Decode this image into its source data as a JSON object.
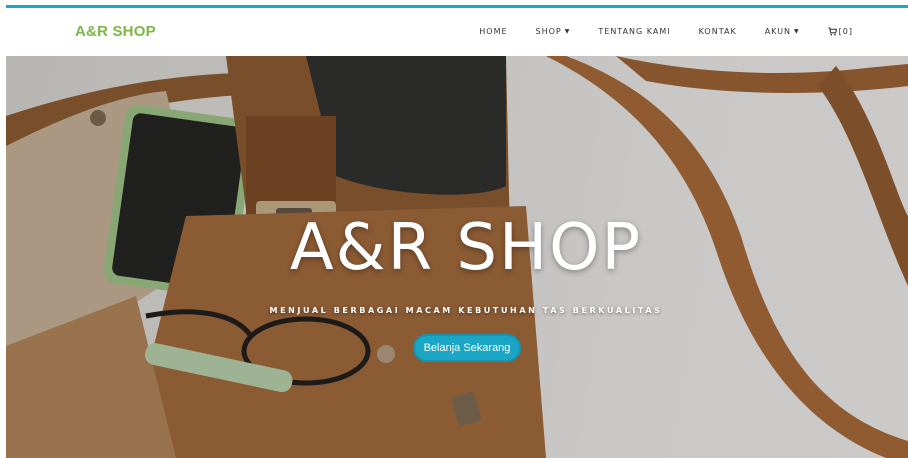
{
  "brand": {
    "name": "A&R SHOP"
  },
  "nav": {
    "home": "HOME",
    "shop": "SHOP",
    "about": "TENTANG KAMI",
    "contact": "KONTAK",
    "account": "AKUN",
    "cart_count": "[0]"
  },
  "hero": {
    "title": "A&R SHOP",
    "subtitle": "MENJUAL BERBAGAI MACAM KEBUTUHAN TAS BERKUALITAS",
    "cta_label": "Belanja Sekarang"
  },
  "colors": {
    "accent": "#1aa6c4",
    "brand": "#7db648"
  },
  "icons": [
    "caret-down-icon",
    "cart-icon"
  ]
}
